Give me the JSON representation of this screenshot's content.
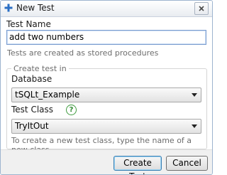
{
  "window": {
    "title": "New Test",
    "icons": {
      "title": "plus-icon",
      "close": "close-icon"
    },
    "accent_color": "#2b6fc4"
  },
  "form": {
    "test_name_label": "Test Name",
    "test_name_value": "add two numbers",
    "test_name_hint": "Tests are created as stored procedures",
    "group_label": "Create test in",
    "database_label": "Database",
    "database_value": "tSQLt_Example",
    "test_class_label": "Test Class",
    "test_class_help_icon": "question-icon",
    "test_class_help_glyph": "?",
    "test_class_value": "TryItOut",
    "test_class_hint": "To create a new test class, type the name of a new class"
  },
  "buttons": {
    "create": "Create Test",
    "cancel": "Cancel"
  }
}
